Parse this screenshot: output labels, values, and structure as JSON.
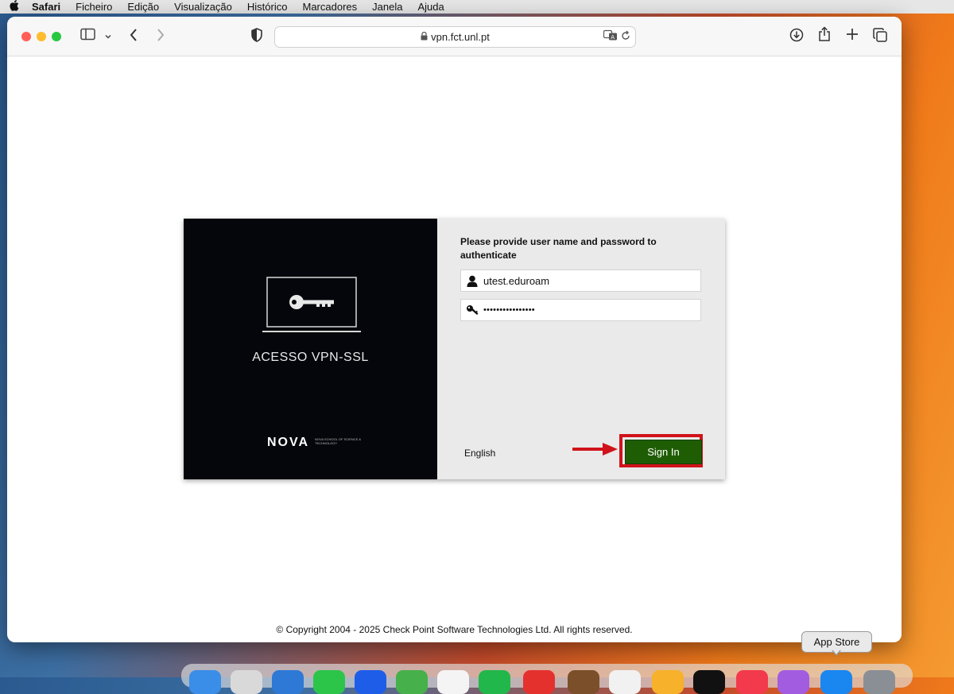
{
  "menubar": {
    "app": "Safari",
    "items": [
      "Ficheiro",
      "Edição",
      "Visualização",
      "Histórico",
      "Marcadores",
      "Janela",
      "Ajuda"
    ]
  },
  "browser": {
    "url": "vpn.fct.unl.pt"
  },
  "login": {
    "brand_title": "ACESSO VPN-SSL",
    "logo_text": "NOVA",
    "logo_subtitle": "NOVA SCHOOL OF SCIENCE & TECHNOLOGY",
    "prompt": "Please provide user name and password to authenticate",
    "username_value": "utest.eduroam",
    "password_value": "••••••••••••••••",
    "language": "English",
    "signin_label": "Sign In"
  },
  "footer": {
    "copyright": "© Copyright 2004 - 2025   Check Point Software Technologies Ltd. All rights reserved."
  },
  "dock": {
    "tooltip": "App Store"
  },
  "colors": {
    "signin_bg": "#1f5d05",
    "highlight": "#d0131b",
    "left_panel": "#04060b",
    "right_panel": "#eaeaea"
  }
}
